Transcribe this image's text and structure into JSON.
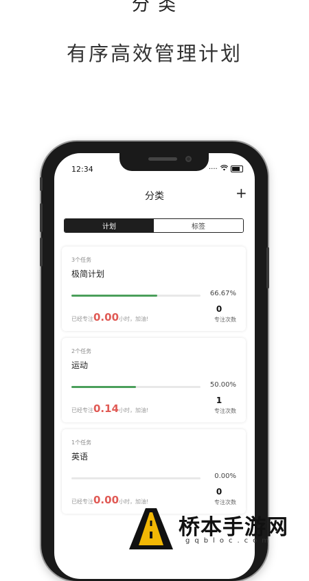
{
  "top_caption_partial": "分  类",
  "headline": "有序高效管理计划",
  "status_bar": {
    "time": "12:34"
  },
  "nav": {
    "title": "分类",
    "add_label": "+"
  },
  "tabs": [
    {
      "label": "计划",
      "active": true
    },
    {
      "label": "标签",
      "active": false
    }
  ],
  "cards": [
    {
      "count_label": "3个任务",
      "name": "极简计划",
      "progress": 0.6667,
      "progress_label": "66.67%",
      "focus_prefix": "已经专注",
      "focus_hours": "0.00",
      "focus_suffix": "小时，加油!",
      "sessions": "0",
      "sessions_label": "专注次数"
    },
    {
      "count_label": "2个任务",
      "name": "运动",
      "progress": 0.5,
      "progress_label": "50.00%",
      "focus_prefix": "已经专注",
      "focus_hours": "0.14",
      "focus_suffix": "小时，加油!",
      "sessions": "1",
      "sessions_label": "专注次数"
    },
    {
      "count_label": "1个任务",
      "name": "英语",
      "progress": 0.0,
      "progress_label": "0.00%",
      "focus_prefix": "已经专注",
      "focus_hours": "0.00",
      "focus_suffix": "小时，加油!",
      "sessions": "0",
      "sessions_label": "专注次数"
    }
  ],
  "colors": {
    "accent_green": "#4a9f5a",
    "focus_red": "#e05a55",
    "tab_active": "#1e1e1e"
  },
  "watermark": {
    "text": "桥本手游网",
    "url": "gqbloc.com"
  }
}
